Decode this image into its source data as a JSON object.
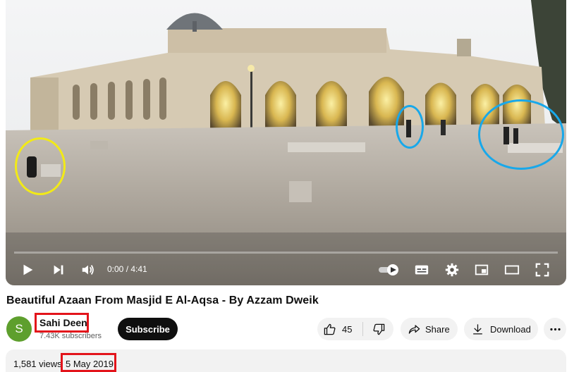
{
  "player": {
    "time_current": "0:00",
    "time_separator": " / ",
    "time_total": "4:41",
    "progress_fraction": 0,
    "icons": [
      "play-icon",
      "next-icon",
      "volume-icon",
      "autoplay-toggle-icon",
      "subtitles-icon",
      "settings-icon",
      "miniplayer-icon",
      "theater-icon",
      "fullscreen-icon"
    ]
  },
  "highlights": {
    "yellow": "#f2ea17",
    "blue": "#18a8ea",
    "red": "#e3141b"
  },
  "video": {
    "title": "Beautiful Azaan From Masjid E Al-Aqsa - By Azzam Dweik"
  },
  "channel": {
    "avatar_letter": "S",
    "avatar_color": "#5e9f2d",
    "name": "Sahi Deen",
    "subscribers": "7.43K subscribers",
    "subscribe_label": "Subscribe"
  },
  "actions": {
    "like_count": "45",
    "share_label": "Share",
    "download_label": "Download"
  },
  "description": {
    "views": "1,581 views",
    "date": "5 May 2019"
  }
}
